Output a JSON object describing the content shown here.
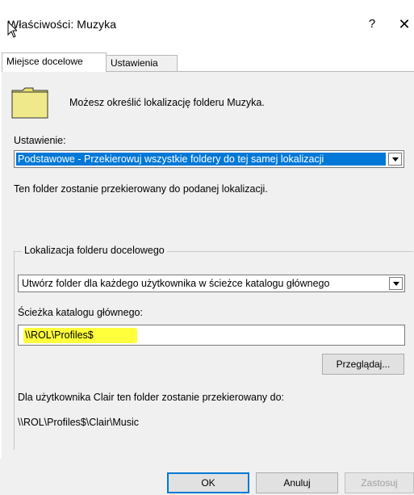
{
  "window": {
    "title": "Właściwości: Muzyka",
    "help_label": "?",
    "close_label": "✕"
  },
  "tabs": [
    {
      "label": "Miejsce docelowe",
      "active": true
    },
    {
      "label": "Ustawienia",
      "active": false
    }
  ],
  "intro": {
    "icon": "folder-icon",
    "text": "Możesz określić lokalizację folderu Muzyka."
  },
  "setting": {
    "label": "Ustawienie:",
    "selected": "Podstawowe - Przekierowuj wszystkie foldery do tej samej lokalizacji",
    "description": "Ten folder zostanie przekierowany do podanej lokalizacji."
  },
  "target": {
    "group_label": "Lokalizacja folderu docelowego",
    "selected": "Utwórz folder dla każdego użytkownika w ścieżce katalogu głównego",
    "root_path_label": "Ścieżka katalogu głównego:",
    "root_path_value": "\\\\ROL\\Profiles$",
    "browse_label": "Przeglądaj...",
    "redirect_note": "Dla użytkownika Clair ten folder zostanie przekierowany do:",
    "redirect_path": "\\\\ROL\\Profiles$\\Clair\\Music"
  },
  "buttons": {
    "ok": "OK",
    "cancel": "Anuluj",
    "apply": "Zastosuj"
  },
  "colors": {
    "selection": "#0078d7",
    "highlight": "#ffff3c",
    "panel": "#f0f0f0"
  }
}
